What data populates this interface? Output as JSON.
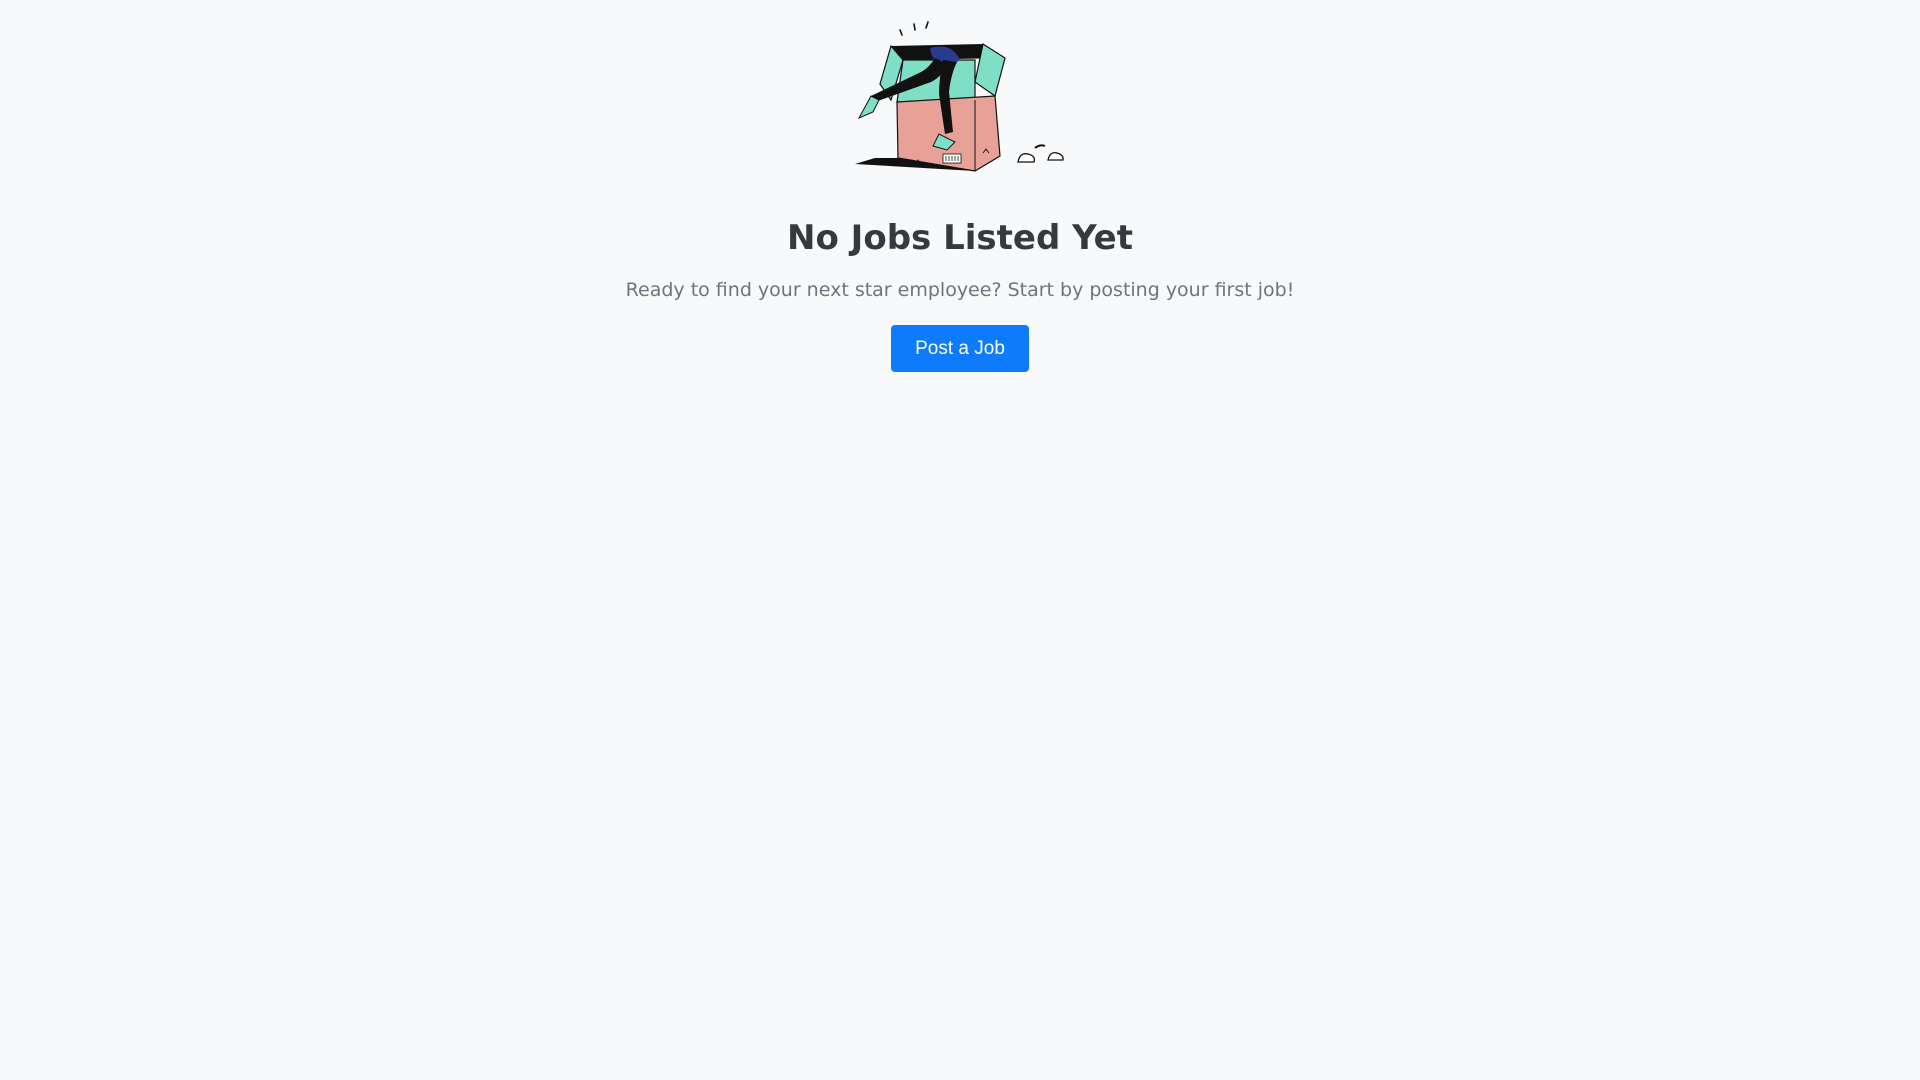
{
  "empty_state": {
    "illustration_icon": "person-diving-into-box-illustration",
    "title": "No Jobs Listed Yet",
    "message": "Ready to find your next star employee? Start by posting your first job!",
    "cta_label": "Post a Job"
  },
  "colors": {
    "background": "#f8f9fa",
    "title": "#343a40",
    "message": "#6c757d",
    "primary": "#0d7bfc",
    "box": "#e8a196",
    "box_flap": "#7fdfc6"
  }
}
